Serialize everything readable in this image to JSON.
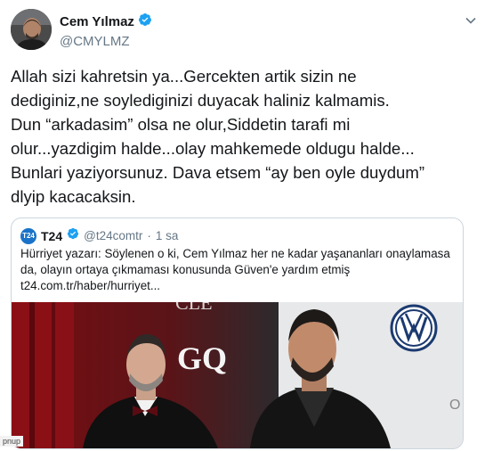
{
  "tweet": {
    "display_name": "Cem Yılmaz",
    "handle": "@CMYLMZ",
    "text_lines": [
      "Allah sizi kahretsin ya...Gercekten artik  sizin ne",
      "dediginiz,ne soylediginizi duyacak haliniz kalmamis.",
      "Dun “arkadasim” olsa ne olur,Siddetin tarafi mi",
      "olur...yazdigim halde...olay mahkemede oldugu halde...",
      "Bunlari yaziyorsunuz. Dava etsem “ay ben oyle duydum”",
      "dlyip kacacaksin."
    ]
  },
  "quote": {
    "logo_text": "T24",
    "name": "T24",
    "handle": "@t24comtr",
    "separator": "·",
    "time": "1 sa",
    "text_lines": [
      "Hürriyet yazarı: Söylenen o ki, Cem Yılmaz her ne kadar yaşananları onaylamasa",
      "da, olayın ortaya çıkmaması konusunda Güven'e yardım etmiş",
      "t24.com.tr/haber/hurriyet..."
    ],
    "media": {
      "backdrop_text_gq": "GQ",
      "backdrop_text_cle": "CLE"
    }
  },
  "corner_text": "pnup",
  "colors": {
    "text_primary": "#14171a",
    "text_secondary": "#657786",
    "verified_blue": "#1da1f2",
    "border": "#ccd6dd"
  },
  "icons": {
    "verified": "verified-badge-icon",
    "menu": "chevron-down-icon",
    "quote_logo": "t24-logo"
  }
}
